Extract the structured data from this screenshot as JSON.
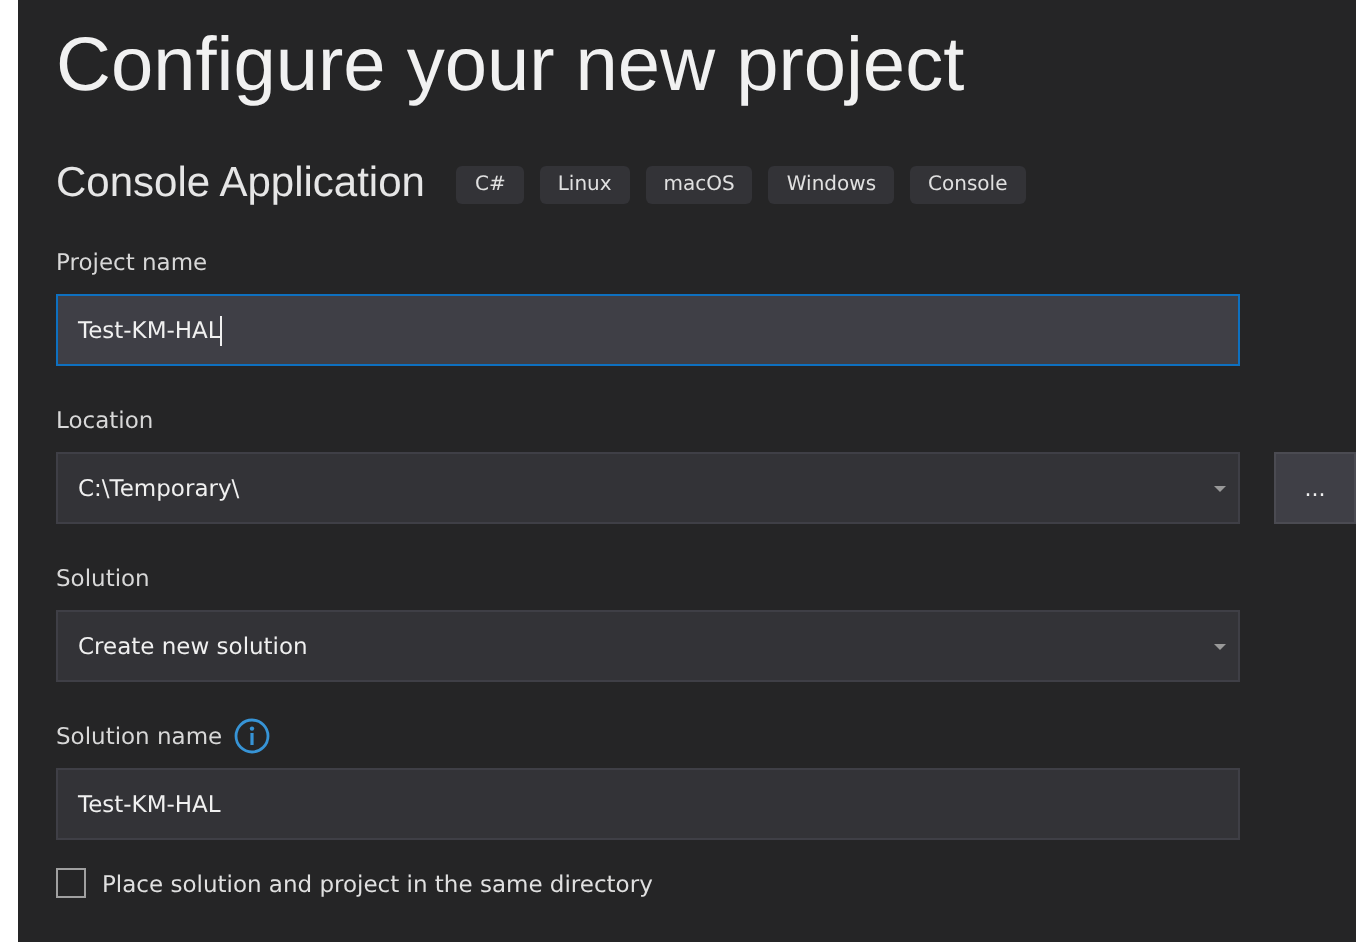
{
  "title": "Configure your new project",
  "template": {
    "name": "Console Application",
    "tags": [
      "C#",
      "Linux",
      "macOS",
      "Windows",
      "Console"
    ]
  },
  "fields": [
    {
      "kind": "text",
      "label": "Project name",
      "value": "Test-KM-HAL",
      "focused": true,
      "info": false
    },
    {
      "kind": "dropdown",
      "label": "Location",
      "value": "C:\\Temporary\\",
      "focused": false,
      "info": false,
      "browse": "..."
    },
    {
      "kind": "dropdown",
      "label": "Solution",
      "value": "Create new solution",
      "focused": false,
      "info": false
    },
    {
      "kind": "text",
      "label": "Solution name",
      "value": "Test-KM-HAL",
      "focused": false,
      "info": true
    }
  ],
  "same_directory": {
    "label": "Place solution and project in the same directory",
    "checked": false
  }
}
